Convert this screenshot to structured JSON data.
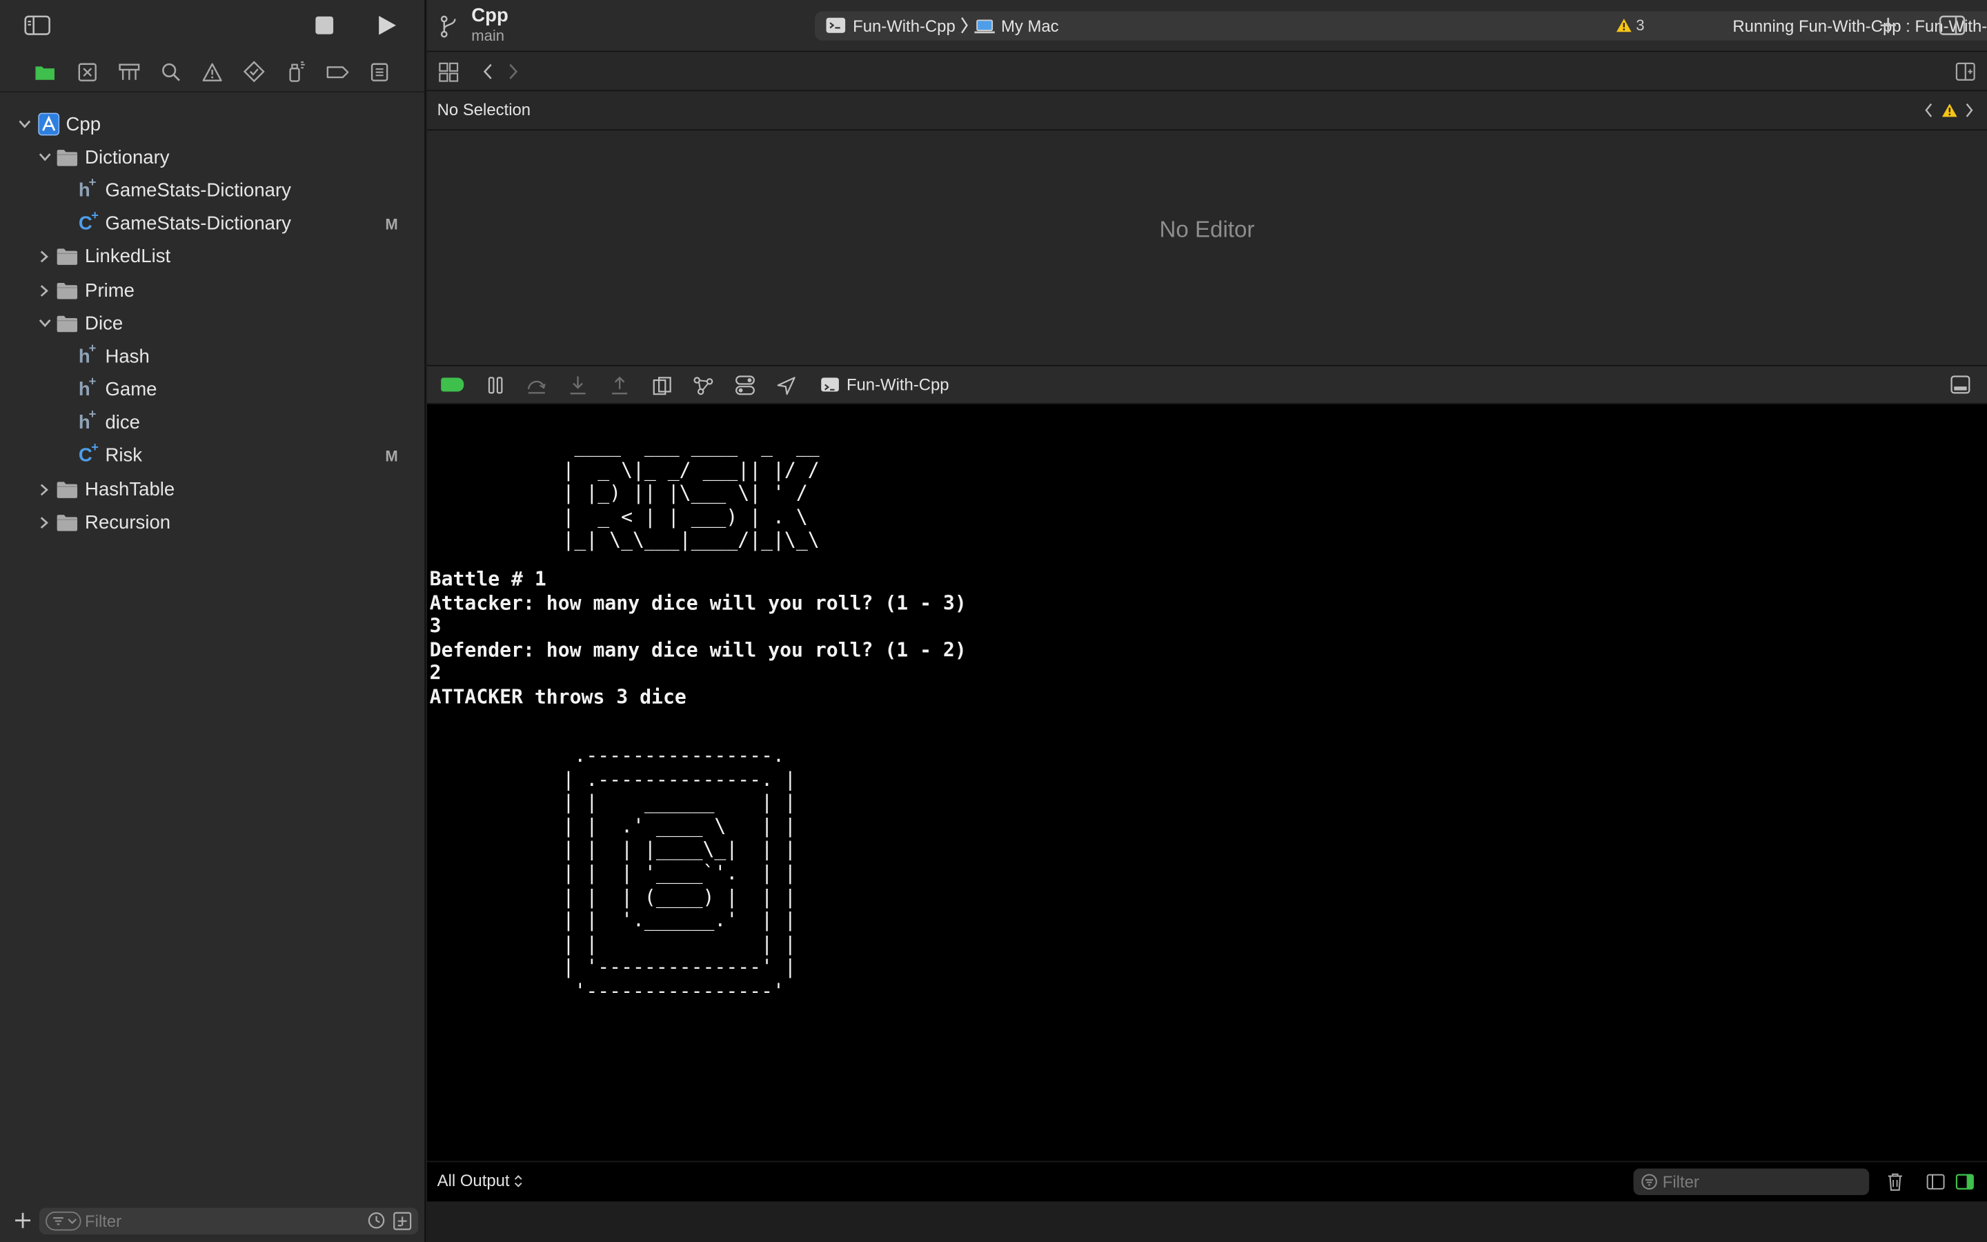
{
  "project": {
    "name": "Cpp"
  },
  "titlebar": {
    "project_name": "Cpp",
    "branch": "main",
    "scheme_target": "Fun-With-Cpp",
    "destination": "My Mac",
    "status": "Running Fun-With-Cpp : Fun-With-Cpp",
    "warning_count": "3"
  },
  "navigator": {
    "tree": [
      {
        "label": "Cpp",
        "kind": "project",
        "expanded": true,
        "level": 0
      },
      {
        "label": "Dictionary",
        "kind": "folder",
        "expanded": true,
        "level": 1
      },
      {
        "label": "GameStats-Dictionary",
        "kind": "header",
        "level": 2,
        "badge": ""
      },
      {
        "label": "GameStats-Dictionary",
        "kind": "source",
        "level": 2,
        "badge": "M"
      },
      {
        "label": "LinkedList",
        "kind": "folder",
        "expanded": false,
        "level": 1
      },
      {
        "label": "Prime",
        "kind": "folder",
        "expanded": false,
        "level": 1
      },
      {
        "label": "Dice",
        "kind": "folder",
        "expanded": true,
        "level": 1
      },
      {
        "label": "Hash",
        "kind": "header",
        "level": 2,
        "badge": ""
      },
      {
        "label": "Game",
        "kind": "header",
        "level": 2,
        "badge": ""
      },
      {
        "label": "dice",
        "kind": "header",
        "level": 2,
        "badge": ""
      },
      {
        "label": "Risk",
        "kind": "source",
        "level": 2,
        "badge": "M"
      },
      {
        "label": "HashTable",
        "kind": "folder",
        "expanded": false,
        "level": 1
      },
      {
        "label": "Recursion",
        "kind": "folder",
        "expanded": false,
        "level": 1
      }
    ],
    "filter_placeholder": "Filter"
  },
  "editor": {
    "breadcrumb": "No Selection",
    "empty_label": "No Editor"
  },
  "debug": {
    "process_name": "Fun-With-Cpp"
  },
  "console": {
    "banner_lines": [
      " ____  ___ ____  _  __",
      "|  _ \\|_ _/ ___|| |/ /",
      "| |_) || |\\___ \\| ' / ",
      "|  _ < | | ___) | . \\ ",
      "|_| \\_\\___|____/|_|\\_\\"
    ],
    "text": "Battle # 1\nAttacker: how many dice will you roll? (1 - 3)\n3\nDefender: how many dice will you roll? (1 - 2)\n2\nATTACKER throws 3 dice",
    "dice_lines": [
      " .----------------.",
      "| .--------------. |",
      "| |    ______    | |",
      "| |  .' ____ \\   | |",
      "| |  | |____\\_|  | |",
      "| |  | '____`'.  | |",
      "| |  | (____) |  | |",
      "| |  '.______.'  | |",
      "| |              | |",
      "| '--------------' |",
      " '----------------'"
    ],
    "output_selector": "All Output",
    "filter_placeholder": "Filter"
  },
  "colors": {
    "sidebar_bg": "#2b2b2b",
    "editor_bg": "#282828",
    "console_bg": "#000000",
    "accent_green": "#3fbf4c",
    "warning_yellow": "#f5c518",
    "source_blue": "#4f9ee8"
  }
}
